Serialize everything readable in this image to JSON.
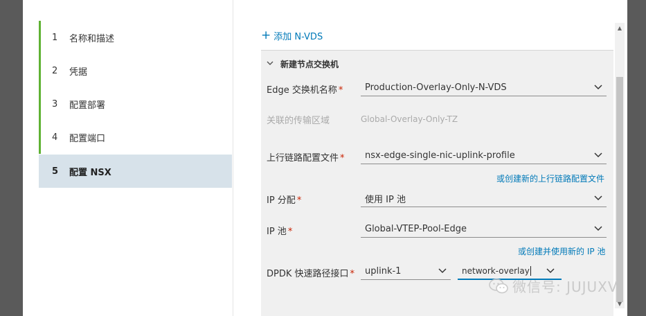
{
  "stepper": {
    "steps": [
      {
        "num": "1",
        "label": "名称和描述"
      },
      {
        "num": "2",
        "label": "凭据"
      },
      {
        "num": "3",
        "label": "配置部署"
      },
      {
        "num": "4",
        "label": "配置端口"
      },
      {
        "num": "5",
        "label": "配置 NSX"
      }
    ],
    "active_index": 4
  },
  "pane": {
    "add_nvds_label": "添加 N-VDS",
    "section_title": "新建节点交换机",
    "fields": {
      "edge_switch": {
        "label": "Edge 交换机名称",
        "value": "Production-Overlay-Only-N-VDS"
      },
      "transport_zone": {
        "label": "关联的传输区域",
        "value": "Global-Overlay-Only-TZ"
      },
      "uplink_profile": {
        "label": "上行链路配置文件",
        "value": "nsx-edge-single-nic-uplink-profile",
        "link": "或创建新的上行链路配置文件"
      },
      "ip_assignment": {
        "label": "IP 分配",
        "value": "使用 IP 池"
      },
      "ip_pool": {
        "label": "IP 池",
        "value": "Global-VTEP-Pool-Edge",
        "link": "或创建并使用新的 IP 池"
      },
      "dpdk": {
        "label": "DPDK 快速路径接口",
        "uplink_value": "uplink-1",
        "input_value": "network-overlay"
      }
    },
    "required_mark": "*"
  },
  "watermark": {
    "text": "微信号: JUJUXV"
  },
  "colors": {
    "accent": "#0079b8",
    "step_complete": "#5fb233",
    "required": "#c92100",
    "active_step_bg": "#d7e2ea"
  }
}
